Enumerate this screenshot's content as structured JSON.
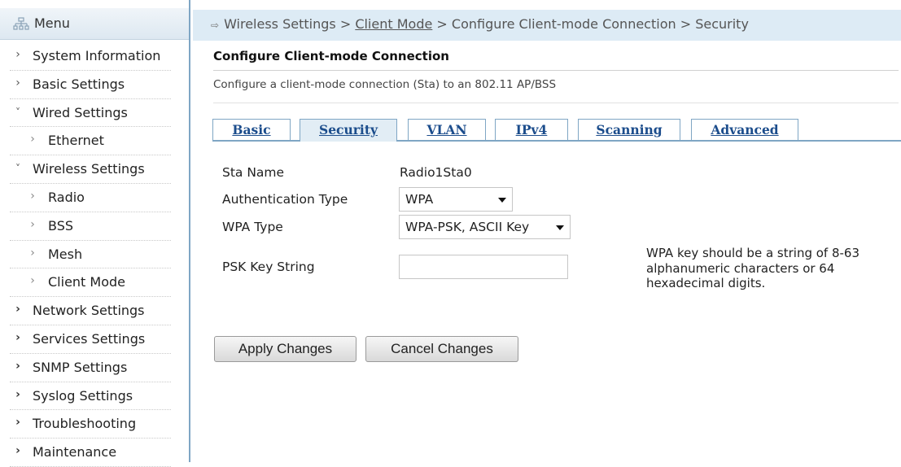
{
  "sidebar": {
    "title": "Menu",
    "items": [
      {
        "label": "System Information",
        "icon": "chevron-right-icon",
        "level": 0
      },
      {
        "label": "Basic Settings",
        "icon": "chevron-right-icon",
        "level": 0
      },
      {
        "label": "Wired Settings",
        "icon": "chevron-down-icon",
        "level": 0
      },
      {
        "label": "Ethernet",
        "icon": "chevron-right-icon",
        "level": 1
      },
      {
        "label": "Wireless Settings",
        "icon": "chevron-down-icon",
        "level": 0
      },
      {
        "label": "Radio",
        "icon": "chevron-right-icon",
        "level": 1
      },
      {
        "label": "BSS",
        "icon": "chevron-right-icon",
        "level": 1
      },
      {
        "label": "Mesh",
        "icon": "chevron-right-icon",
        "level": 1
      },
      {
        "label": "Client Mode",
        "icon": "chevron-right-icon",
        "level": 1
      },
      {
        "label": "Network Settings",
        "icon": "chevron-right-icon",
        "level": 0
      },
      {
        "label": "Services Settings",
        "icon": "chevron-right-icon",
        "level": 0
      },
      {
        "label": "SNMP Settings",
        "icon": "chevron-right-icon",
        "level": 0
      },
      {
        "label": "Syslog Settings",
        "icon": "chevron-right-icon",
        "level": 0
      },
      {
        "label": "Troubleshooting",
        "icon": "chevron-right-icon",
        "level": 0
      },
      {
        "label": "Maintenance",
        "icon": "chevron-right-icon",
        "level": 0
      }
    ]
  },
  "breadcrumb": {
    "part1": "Wireless Settings",
    "link": "Client Mode",
    "part3": "Configure Client-mode Connection",
    "part4": "Security",
    "separator": ">"
  },
  "page": {
    "title": "Configure Client-mode Connection",
    "description": "Configure a client-mode connection (Sta) to an 802.11 AP/BSS"
  },
  "tabs": [
    "Basic",
    "Security",
    "VLAN",
    "IPv4",
    "Scanning",
    "Advanced"
  ],
  "active_tab": "Security",
  "form": {
    "sta_name_label": "Sta Name",
    "sta_name_value": "Radio1Sta0",
    "auth_type_label": "Authentication Type",
    "auth_type_value": "WPA",
    "wpa_type_label": "WPA Type",
    "wpa_type_value": "WPA-PSK, ASCII Key",
    "psk_label": "PSK Key String",
    "psk_value": "",
    "psk_help": "WPA key should be a string of 8-63 alphanumeric characters or 64 hexadecimal digits."
  },
  "buttons": {
    "apply": "Apply Changes",
    "cancel": "Cancel Changes"
  },
  "colors": {
    "accent_border": "#7fa6c4",
    "breadcrumb_bg": "#ddebf5",
    "tab_text": "#1c4d8c"
  }
}
